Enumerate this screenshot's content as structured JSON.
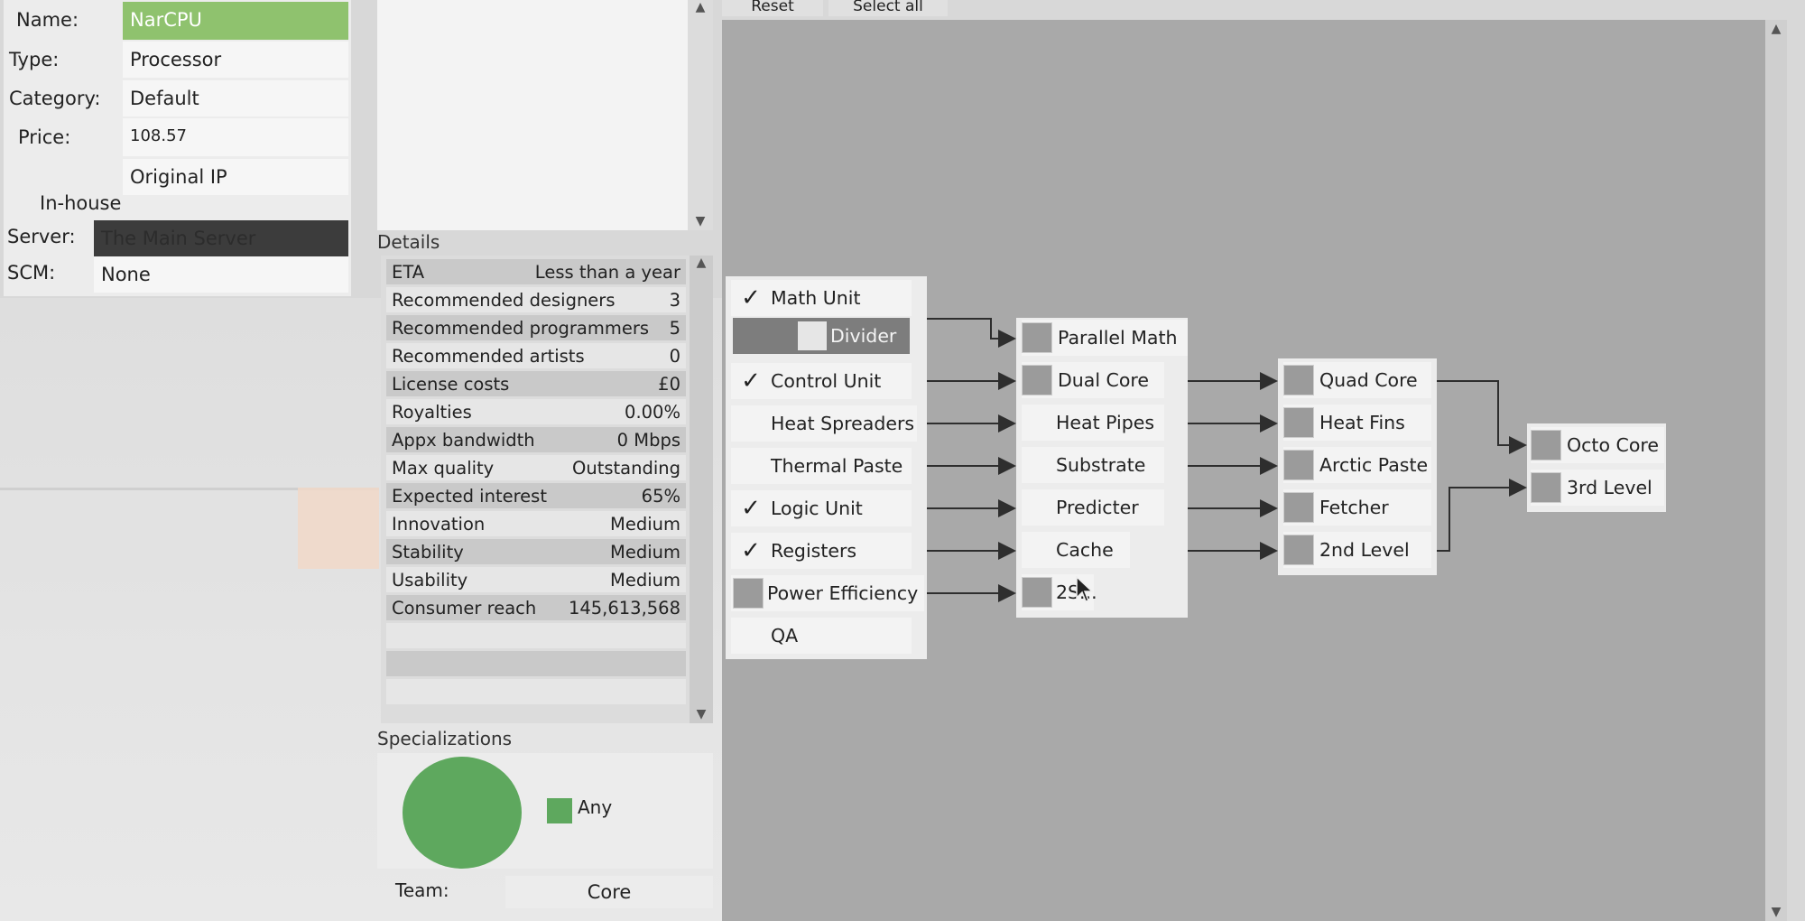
{
  "properties": {
    "name_label": "Name:",
    "name_value": "NarCPU",
    "type_label": "Type:",
    "type_value": "Processor",
    "category_label": "Category:",
    "category_value": "Default",
    "price_label": "Price:",
    "price_value": "108.57",
    "ip_value": "Original IP",
    "inhouse_label": "In-house",
    "server_label": "Server:",
    "server_value": "The Main Server",
    "scm_label": "SCM:",
    "scm_value": "None"
  },
  "top_buttons": {
    "reset": "Reset",
    "select_all": "Select all"
  },
  "details": {
    "title": "Details",
    "rows": [
      {
        "label": "ETA",
        "value": "Less than a year"
      },
      {
        "label": "Recommended designers",
        "value": "3"
      },
      {
        "label": "Recommended programmers",
        "value": "5"
      },
      {
        "label": "Recommended artists",
        "value": "0"
      },
      {
        "label": "License costs",
        "value": "£0"
      },
      {
        "label": "Royalties",
        "value": "0.00%"
      },
      {
        "label": "Appx bandwidth",
        "value": "0 Mbps"
      },
      {
        "label": "Max quality",
        "value": "Outstanding"
      },
      {
        "label": "Expected interest",
        "value": "65%"
      },
      {
        "label": "Innovation",
        "value": "Medium"
      },
      {
        "label": "Stability",
        "value": "Medium"
      },
      {
        "label": "Usability",
        "value": "Medium"
      },
      {
        "label": "Consumer reach",
        "value": "145,613,568"
      }
    ]
  },
  "specializations": {
    "title": "Specializations",
    "legend": "Any",
    "color": "#5ea85e"
  },
  "team": {
    "label": "Team:",
    "value": "Core"
  },
  "tree": {
    "col1": [
      {
        "label": "Math Unit",
        "checked": true
      },
      {
        "label": "Divider",
        "checked": false
      },
      {
        "label": "Control Unit",
        "checked": true
      },
      {
        "label": "Heat Spreaders",
        "checked": false
      },
      {
        "label": "Thermal Paste",
        "checked": false
      },
      {
        "label": "Logic Unit",
        "checked": true
      },
      {
        "label": "Registers",
        "checked": true
      },
      {
        "label": "Power Efficiency",
        "checked": false
      },
      {
        "label": "QA",
        "checked": false
      }
    ],
    "col2": [
      {
        "label": "Parallel Math"
      },
      {
        "label": "Dual Core"
      },
      {
        "label": "Heat Pipes"
      },
      {
        "label": "Substrate"
      },
      {
        "label": "Predicter"
      },
      {
        "label": "Cache"
      },
      {
        "label": "2S..."
      }
    ],
    "col3": [
      {
        "label": "Quad Core"
      },
      {
        "label": "Heat Fins"
      },
      {
        "label": "Arctic Paste"
      },
      {
        "label": "Fetcher"
      },
      {
        "label": "2nd Level"
      }
    ],
    "col4": [
      {
        "label": "Octo Core"
      },
      {
        "label": "3rd Level"
      }
    ],
    "check_glyph": "✓"
  }
}
